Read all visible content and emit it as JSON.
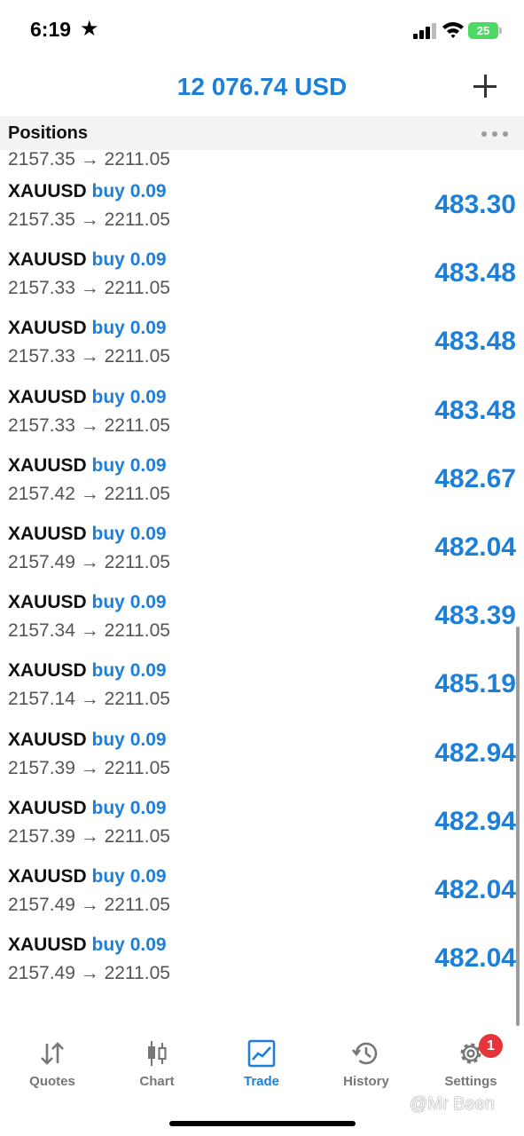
{
  "status_bar": {
    "time": "6:19",
    "star_icon": "star",
    "battery": "25"
  },
  "header": {
    "balance": "12 076.74 USD",
    "add_icon": "plus-icon"
  },
  "section": {
    "title": "Positions",
    "more_icon": "ellipsis-icon"
  },
  "partial_row": {
    "prices": "2157.35 → 2211.05"
  },
  "positions": [
    {
      "symbol": "XAUUSD",
      "direction": "buy 0.09",
      "prices": "2157.35 → 2211.05",
      "profit": "483.30"
    },
    {
      "symbol": "XAUUSD",
      "direction": "buy 0.09",
      "prices": "2157.33 → 2211.05",
      "profit": "483.48"
    },
    {
      "symbol": "XAUUSD",
      "direction": "buy 0.09",
      "prices": "2157.33 → 2211.05",
      "profit": "483.48"
    },
    {
      "symbol": "XAUUSD",
      "direction": "buy 0.09",
      "prices": "2157.33 → 2211.05",
      "profit": "483.48"
    },
    {
      "symbol": "XAUUSD",
      "direction": "buy 0.09",
      "prices": "2157.42 → 2211.05",
      "profit": "482.67"
    },
    {
      "symbol": "XAUUSD",
      "direction": "buy 0.09",
      "prices": "2157.49 → 2211.05",
      "profit": "482.04"
    },
    {
      "symbol": "XAUUSD",
      "direction": "buy 0.09",
      "prices": "2157.34 → 2211.05",
      "profit": "483.39"
    },
    {
      "symbol": "XAUUSD",
      "direction": "buy 0.09",
      "prices": "2157.14 → 2211.05",
      "profit": "485.19"
    },
    {
      "symbol": "XAUUSD",
      "direction": "buy 0.09",
      "prices": "2157.39 → 2211.05",
      "profit": "482.94"
    },
    {
      "symbol": "XAUUSD",
      "direction": "buy 0.09",
      "prices": "2157.39 → 2211.05",
      "profit": "482.94"
    },
    {
      "symbol": "XAUUSD",
      "direction": "buy 0.09",
      "prices": "2157.49 → 2211.05",
      "profit": "482.04"
    },
    {
      "symbol": "XAUUSD",
      "direction": "buy 0.09",
      "prices": "2157.49 → 2211.05",
      "profit": "482.04"
    }
  ],
  "tabs": [
    {
      "label": "Quotes",
      "icon": "quotes-arrows-icon"
    },
    {
      "label": "Chart",
      "icon": "candlestick-icon"
    },
    {
      "label": "Trade",
      "icon": "trade-chart-icon",
      "active": true
    },
    {
      "label": "History",
      "icon": "history-clock-icon"
    },
    {
      "label": "Settings",
      "icon": "gear-icon"
    }
  ],
  "settings_badge": "1",
  "watermark": "@Mr Been",
  "colors": {
    "accent": "#1e7fd8",
    "badge": "#e8333a",
    "section_bg": "#f3f3f3"
  }
}
